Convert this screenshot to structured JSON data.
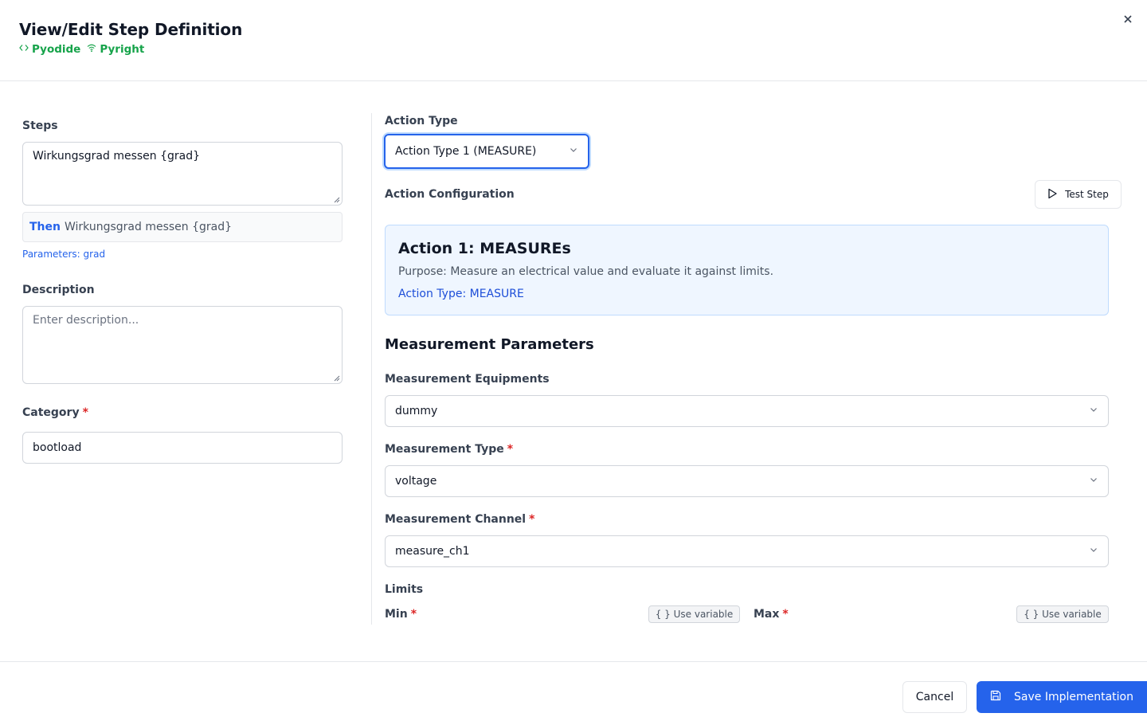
{
  "dialog": {
    "title": "View/Edit Step Definition",
    "status": [
      {
        "label": "Pyodide",
        "icon": "code-icon"
      },
      {
        "label": "Pyright",
        "icon": "wifi-icon"
      }
    ],
    "close_icon": "close-icon"
  },
  "left": {
    "steps_label": "Steps",
    "steps_value": "Wirkungsgrad messen {grad}",
    "preview_keyword": "Then",
    "preview_text": "Wirkungsgrad messen {grad}",
    "parameters": "Parameters: grad",
    "description_label": "Description",
    "description_placeholder": "Enter description...",
    "category_label": "Category",
    "category_value": "bootload",
    "required_mark": "*"
  },
  "right": {
    "action_type_label": "Action Type",
    "action_type_value": "Action Type 1 (MEASURE)",
    "action_config_label": "Action Configuration",
    "test_step_label": "Test Step",
    "info": {
      "title": "Action 1: MEASUREs",
      "purpose": "Purpose: Measure an electrical value and evaluate it against limits.",
      "action_type": "Action Type: MEASURE"
    },
    "section_title": "Measurement Parameters",
    "equipments_label": "Measurement Equipments",
    "equipments_value": "dummy",
    "type_label": "Measurement Type",
    "type_value": "voltage",
    "channel_label": "Measurement Channel",
    "channel_value": "measure_ch1",
    "limits_label": "Limits",
    "min_label": "Min",
    "max_label": "Max",
    "use_variable_label": "{ } Use variable"
  },
  "footer": {
    "cancel_label": "Cancel",
    "save_label": "Save Implementation"
  },
  "colors": {
    "accent": "#2563eb",
    "status_green": "#16a34a",
    "required_red": "#dc2626",
    "info_bg": "#eff6ff"
  }
}
